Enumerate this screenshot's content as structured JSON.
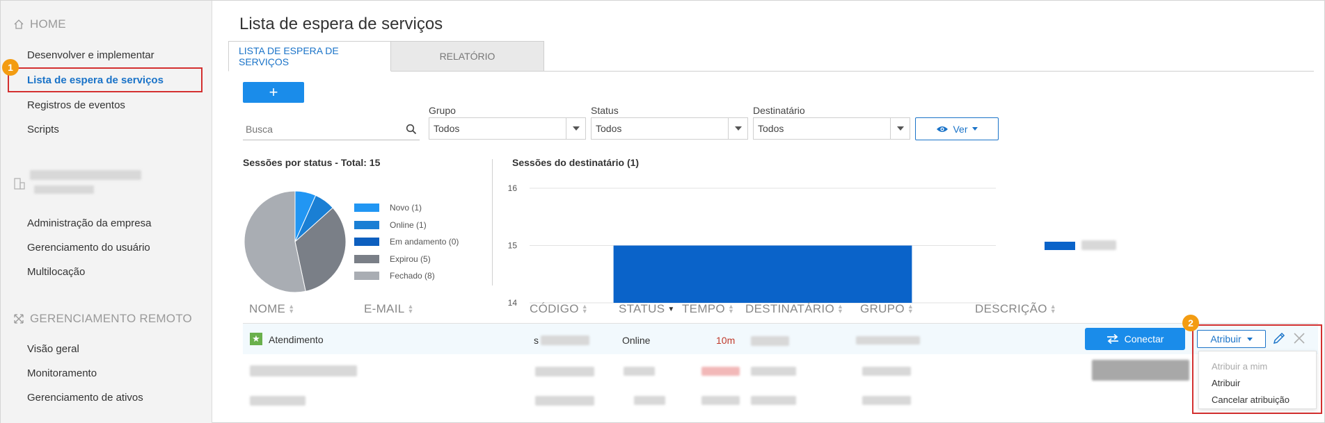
{
  "sidebar": {
    "home_title": "HOME",
    "items_home": [
      {
        "label": "Desenvolver e implementar"
      },
      {
        "label": "Lista de espera de serviços"
      },
      {
        "label": "Registros de eventos"
      },
      {
        "label": "Scripts"
      }
    ],
    "items_company": [
      {
        "label": "Administração da empresa"
      },
      {
        "label": "Gerenciamento do usuário"
      },
      {
        "label": "Multilocação"
      }
    ],
    "remote_title": "GERENCIAMENTO REMOTO",
    "items_remote": [
      {
        "label": "Visão geral"
      },
      {
        "label": "Monitoramento"
      },
      {
        "label": "Gerenciamento de ativos"
      }
    ],
    "marker": "1"
  },
  "main": {
    "title": "Lista de espera de serviços",
    "tabs": [
      {
        "label": "LISTA DE ESPERA DE SERVIÇOS"
      },
      {
        "label": "RELATÓRIO"
      }
    ],
    "add_label": "+",
    "search": {
      "placeholder": "Busca"
    },
    "filters": {
      "grupo": {
        "label": "Grupo",
        "value": "Todos"
      },
      "status": {
        "label": "Status",
        "value": "Todos"
      },
      "destinatario": {
        "label": "Destinatário",
        "value": "Todos"
      }
    },
    "ver_label": "Ver"
  },
  "chart_data": [
    {
      "type": "pie",
      "title": "Sessões por status - Total: 15",
      "categories": [
        "Novo",
        "Online",
        "Em andamento",
        "Expirou",
        "Fechado"
      ],
      "values": [
        1,
        1,
        0,
        5,
        8
      ],
      "legend_labels": [
        "Novo (1)",
        "Online (1)",
        "Em andamento (0)",
        "Expirou (5)",
        "Fechado (8)"
      ],
      "colors": [
        "#2196f3",
        "#1a7fd4",
        "#0d5fbf",
        "#7a7f87",
        "#a9adb3"
      ],
      "legend": "right"
    },
    {
      "type": "bar",
      "title": "Sessões do destinatário (1)",
      "categories": [
        ""
      ],
      "values": [
        15
      ],
      "ylim": [
        14,
        16
      ],
      "yticks": [
        "16",
        "15",
        "14"
      ],
      "grid": true,
      "color": "#0a63c9",
      "legend": "right"
    }
  ],
  "table": {
    "headers": [
      "NOME",
      "E-MAIL",
      "CÓDIGO",
      "STATUS",
      "TEMPO",
      "DESTINATÁRIO",
      "GRUPO",
      "DESCRIÇÃO"
    ],
    "row1": {
      "name": "Atendimento",
      "codigo_prefix": "s",
      "status": "Online",
      "tempo": "10m"
    },
    "connect_label": "Conectar",
    "attr_label": "Atribuir",
    "attr_marker": "2",
    "dropdown": {
      "assign_me": "Atribuir a mim",
      "assign": "Atribuir",
      "cancel": "Cancelar atribuição"
    }
  },
  "colors": {
    "accent": "#1a8cea",
    "link": "#1a73c8",
    "highlight": "#d32f2f",
    "marker": "#f39c12",
    "time_red": "#c0392b"
  }
}
